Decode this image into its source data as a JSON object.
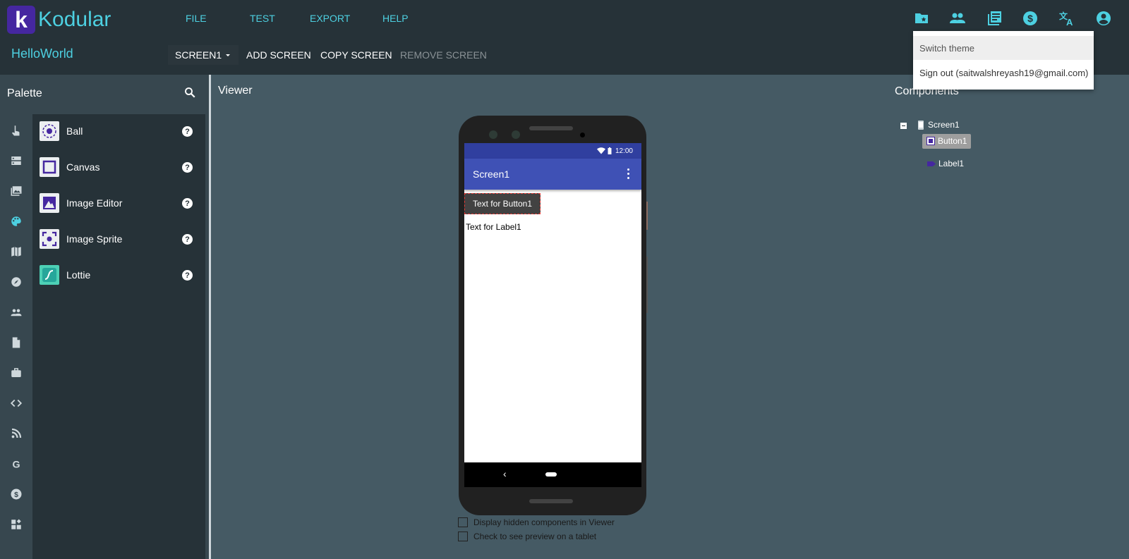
{
  "app": {
    "logo_letter": "k",
    "logo_text": "Kodular",
    "project_name": "HelloWorld"
  },
  "menu": [
    "FILE",
    "TEST",
    "EXPORT",
    "HELP"
  ],
  "screen_toolbar": {
    "screen_select": "SCREEN1",
    "add_screen": "ADD SCREEN",
    "copy_screen": "COPY SCREEN",
    "remove_screen": "REMOVE SCREEN"
  },
  "top_icons": [
    "folder-star-icon",
    "people-icon",
    "library-icon",
    "dollar-icon",
    "translate-icon",
    "account-icon"
  ],
  "dropdown": {
    "switch_theme": "Switch theme",
    "sign_out": "Sign out (saitwalshreyash19@gmail.com)"
  },
  "palette": {
    "title": "Palette",
    "categories": [
      "touch-icon",
      "layout-icon",
      "media-icon",
      "drawing-icon",
      "maps-icon",
      "sensors-icon",
      "social-icon",
      "storage-icon",
      "utilities-icon",
      "code-icon",
      "connectivity-icon",
      "google-icon",
      "monetization-icon",
      "extensions-icon"
    ],
    "items": [
      {
        "name": "Ball",
        "icon": "ball-icon"
      },
      {
        "name": "Canvas",
        "icon": "canvas-icon"
      },
      {
        "name": "Image Editor",
        "icon": "image-editor-icon"
      },
      {
        "name": "Image Sprite",
        "icon": "image-sprite-icon"
      },
      {
        "name": "Lottie",
        "icon": "lottie-icon"
      }
    ],
    "help_glyph": "?"
  },
  "viewer": {
    "title": "Viewer",
    "status_time": "12:00",
    "screen_title": "Screen1",
    "button_text": "Text for Button1",
    "label_text": "Text for Label1",
    "back_glyph": "‹",
    "check_hidden": "Display hidden components in Viewer",
    "check_tablet": "Check to see preview on a tablet"
  },
  "components": {
    "title": "Components",
    "tree": {
      "root": "Screen1",
      "children": [
        "Button1",
        "Label1"
      ]
    }
  },
  "colors": {
    "accent": "#4dd0e1",
    "brand": "#4527a0",
    "appbar": "#3f51b5",
    "statusbar": "#303f9f"
  }
}
